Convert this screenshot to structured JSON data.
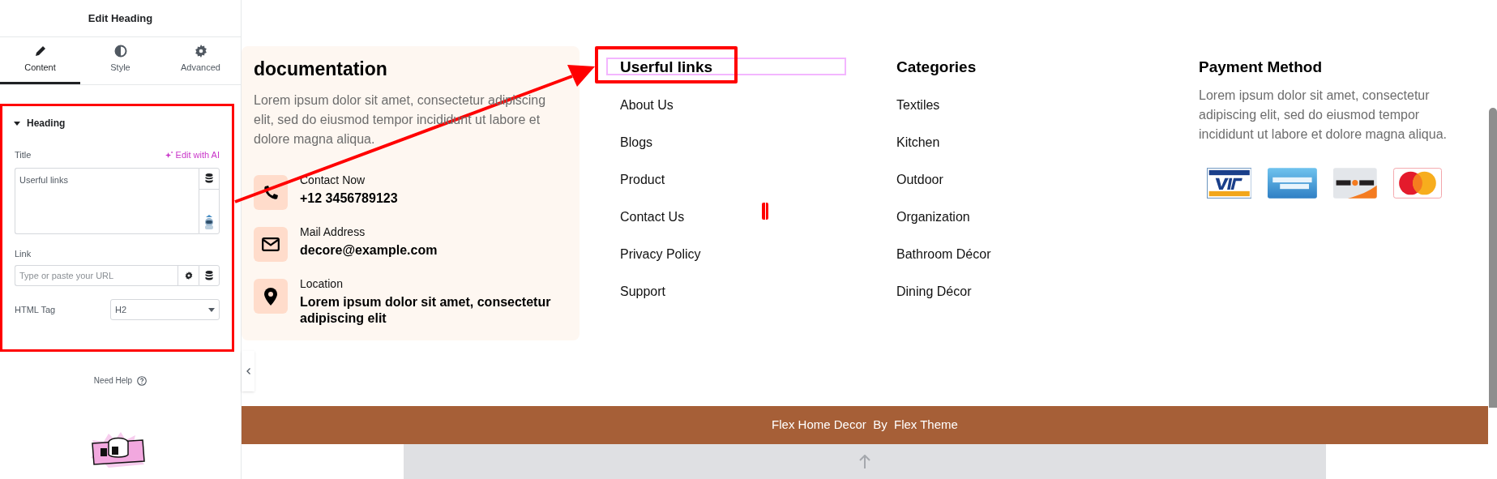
{
  "panel": {
    "title": "Edit Heading",
    "tabs": [
      {
        "label": "Content",
        "selected": true
      },
      {
        "label": "Style",
        "selected": false
      },
      {
        "label": "Advanced",
        "selected": false
      }
    ],
    "section": {
      "title": "Heading",
      "expanded": true
    },
    "title_label": "Title",
    "ai_link": "Edit with AI",
    "title_value": "Userful links",
    "link_label": "Link",
    "link_placeholder": "Type or paste your URL",
    "html_tag_label": "HTML Tag",
    "html_tag_value": "H2",
    "need_help": "Need Help"
  },
  "contact_card": {
    "heading": "documentation",
    "text": "Lorem ipsum dolor sit amet, consectetur adipiscing elit, sed do eiusmod tempor incididunt ut labore et dolore magna aliqua.",
    "items": [
      {
        "kind": "phone",
        "label": "Contact Now",
        "value": "+12 3456789123"
      },
      {
        "kind": "mail",
        "label": "Mail Address",
        "value": "decore@example.com"
      },
      {
        "kind": "location",
        "label": "Location",
        "value": "Lorem ipsum dolor sit amet, consectetur adipiscing elit"
      }
    ]
  },
  "useful_links": {
    "heading": "Userful links",
    "links": [
      "About Us",
      "Blogs",
      "Product",
      "Contact Us",
      "Privacy Policy",
      "Support"
    ]
  },
  "categories": {
    "heading": "Categories",
    "links": [
      "Textiles",
      "Kitchen",
      "Outdoor",
      "Organization",
      "Bathroom Décor",
      "Dining Décor"
    ]
  },
  "payment": {
    "heading": "Payment Method",
    "text": "Lorem ipsum dolor sit amet, consectetur adipiscing elit, sed do eiusmod tempor incididunt ut labore et dolore magna aliqua.",
    "cards": [
      {
        "kind": "visa"
      },
      {
        "kind": "amex"
      },
      {
        "kind": "discover"
      },
      {
        "kind": "mastercard"
      }
    ]
  },
  "copyright": "Flex Home Decor  By  Flex Theme"
}
